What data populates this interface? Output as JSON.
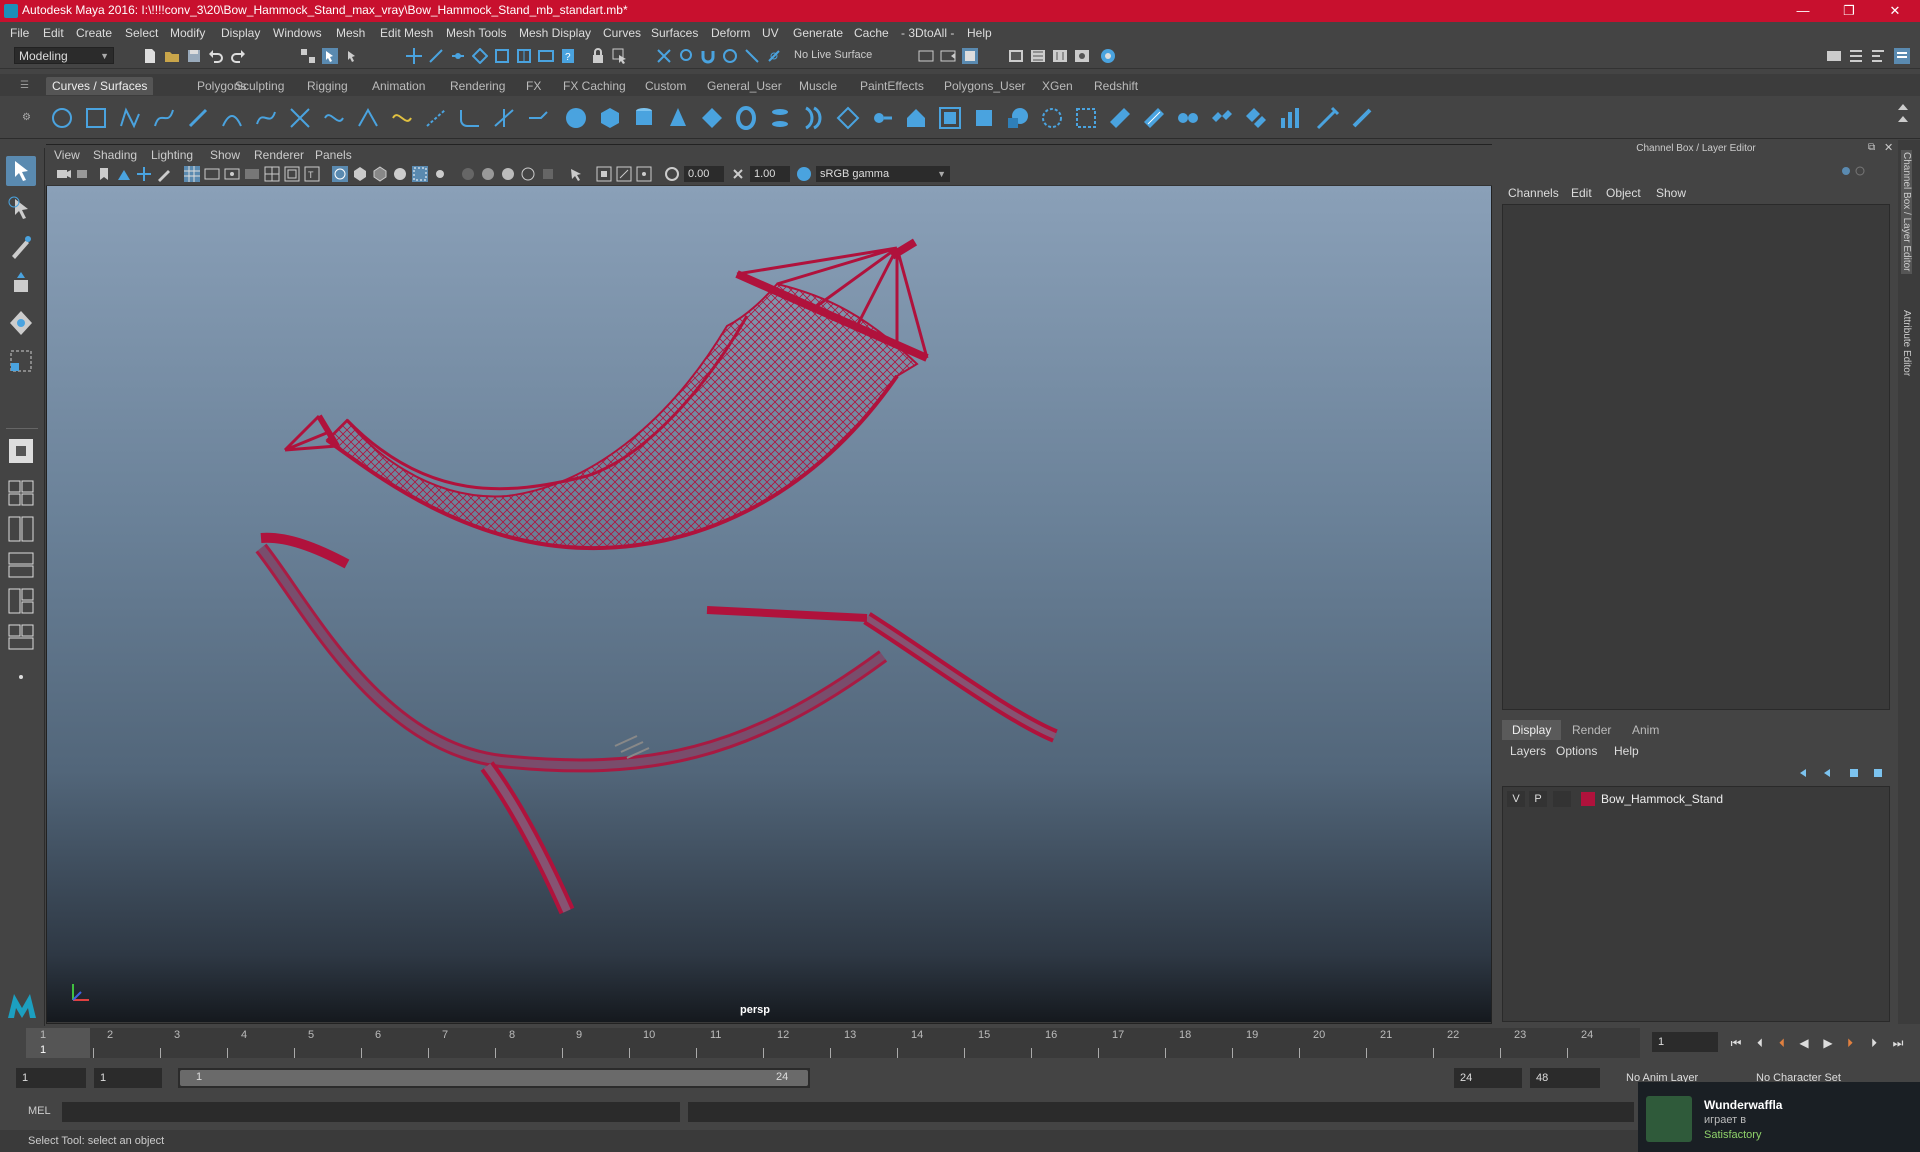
{
  "window": {
    "title": "Autodesk Maya 2016: I:\\!!!!conv_3\\20\\Bow_Hammock_Stand_max_vray\\Bow_Hammock_Stand_mb_standart.mb*",
    "minimize": "—",
    "restore": "❐",
    "close": "✕"
  },
  "menubar": [
    "File",
    "Edit",
    "Create",
    "Select",
    "Modify",
    "Display",
    "Windows",
    "Mesh",
    "Edit Mesh",
    "Mesh Tools",
    "Mesh Display",
    "Curves",
    "Surfaces",
    "Deform",
    "UV",
    "Generate",
    "Cache",
    "- 3DtoAll -",
    "Help"
  ],
  "statusline": {
    "mode": "Modeling",
    "live_surface": "No Live Surface"
  },
  "shelf_tabs": [
    "Curves / Surfaces",
    "Polygons",
    "Sculpting",
    "Rigging",
    "Animation",
    "Rendering",
    "FX",
    "FX Caching",
    "Custom",
    "General_User",
    "Muscle",
    "PaintEffects",
    "Polygons_User",
    "XGen",
    "Redshift"
  ],
  "viewport": {
    "menu": [
      "View",
      "Shading",
      "Lighting",
      "Show",
      "Renderer",
      "Panels"
    ],
    "exposure": "0.00",
    "gamma": "1.00",
    "color_space": "sRGB gamma",
    "camera_label": "persp"
  },
  "right_panel": {
    "title": "Channel Box / Layer Editor",
    "menu": [
      "Channels",
      "Edit",
      "Object",
      "Show"
    ],
    "layer_tabs": [
      "Display",
      "Render",
      "Anim"
    ],
    "layer_menu": [
      "Layers",
      "Options",
      "Help"
    ],
    "layer": {
      "v": "V",
      "p": "P",
      "name": "Bow_Hammock_Stand",
      "color": "#b0123c"
    },
    "side_tabs": [
      "Channel Box / Layer Editor",
      "Attribute Editor"
    ]
  },
  "timeline": {
    "ticks": [
      "1",
      "2",
      "3",
      "4",
      "5",
      "6",
      "7",
      "8",
      "9",
      "10",
      "11",
      "12",
      "13",
      "14",
      "15",
      "16",
      "17",
      "18",
      "19",
      "20",
      "21",
      "22",
      "23",
      "24"
    ],
    "current_frame_label": "1",
    "current_frame_field": "1"
  },
  "range": {
    "start": "1",
    "playback_start": "1",
    "slider_start": "1",
    "slider_end": "24",
    "playback_end": "24",
    "end": "48",
    "anim_layer": "No Anim Layer",
    "char_set": "No Character Set"
  },
  "cmdline": {
    "label": "MEL"
  },
  "helpline": {
    "text": "Select Tool: select an object"
  },
  "toast": {
    "user": "Wunderwaffla",
    "status": "играет в",
    "game": "Satisfactory"
  }
}
